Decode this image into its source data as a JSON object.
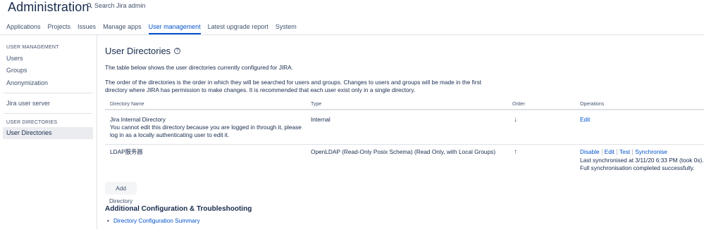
{
  "header": {
    "title": "Administration",
    "search_placeholder": "Search Jira admin"
  },
  "nav": {
    "tabs": [
      "Applications",
      "Projects",
      "Issues",
      "Manage apps",
      "User management",
      "Latest upgrade report",
      "System"
    ],
    "active": "User management"
  },
  "sidebar": {
    "section1_heading": "USER MANAGEMENT",
    "items1": [
      "Users",
      "Groups",
      "Anonymization"
    ],
    "item2": "Jira user server",
    "section2_heading": "USER DIRECTORIES",
    "active_item": "User Directories"
  },
  "main": {
    "title": "User Directories",
    "intro": "The table below shows the user directories currently configured for JIRA.",
    "order_text_line1": "The order of the directories is the order in which they will be searched for users and groups. Changes to users and groups will be made in the first",
    "order_text_line2": "directory where JIRA has permission to make changes. It is recommended that each user exist only in a single directory.",
    "table": {
      "headers": {
        "name": "Directory Name",
        "type": "Type",
        "order": "Order",
        "operations": "Operations"
      },
      "rows": [
        {
          "name": "Jira Internal Directory",
          "note_line1": "You cannot edit this directory because you are logged in through it, please",
          "note_line2": "log in as a locally authenticating user to edit it.",
          "type": "Internal",
          "order_arrow": "↓",
          "ops": [
            "Edit"
          ]
        },
        {
          "name": "LDAP服务器",
          "type": "OpenLDAP (Read-Only Posix Schema) (Read Only, with Local Groups)",
          "order_arrow": "↑",
          "ops": [
            "Disable",
            "Edit",
            "Test",
            "Synchronise"
          ],
          "sync_line1": "Last synchronised at 3/11/20 6:33 PM (took 0s).",
          "sync_line2": "Full synchronisation completed successfully."
        }
      ]
    },
    "add_button": "Add Directory",
    "section_title": "Additional Configuration & Troubleshooting",
    "link": "Directory Configuration Summary"
  }
}
